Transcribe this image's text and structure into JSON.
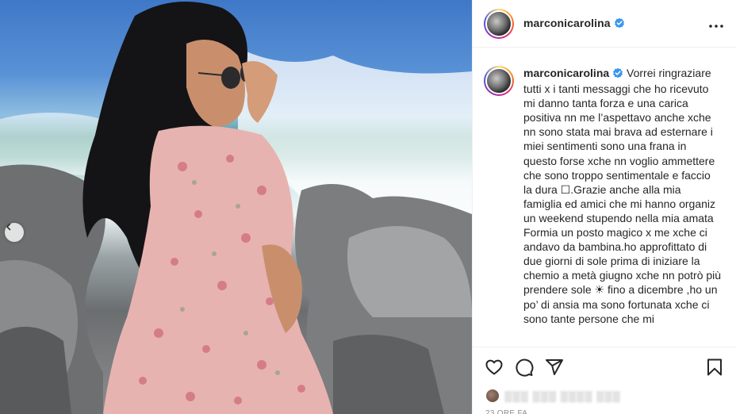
{
  "post": {
    "username": "marconicarolina",
    "verified": true,
    "caption": "Vorrei ringraziare tutti x i tanti messaggi che ho ricevuto mi danno tanta forza e una carica positiva nn me l’aspettavo anche xche nn sono stata mai brava ad esternare i miei sentimenti sono una frana in questo forse xche nn voglio ammettere che sono troppo sentimentale e faccio la dura ☐.Grazie anche alla mia famiglia ed amici che mi hanno organiz un weekend stupendo nella mia amata Formia un posto magico x me xche ci andavo da bambina.ho approfittato di due giorni di sole prima di iniziare la chemio a metà giugno xche nn potrò più prendere sole ☀ fino a dicembre ,ho un po’ di ansia ma sono fortunata xche ci sono tante persone che mi",
    "likes_text": "░░░  ░░░ ░░░░ ░░░",
    "time_label": "23 ORE FA"
  },
  "icons": {
    "verified": "verified-badge-icon",
    "more": "more-options-icon",
    "like": "heart-icon",
    "comment": "comment-icon",
    "share": "paper-plane-icon",
    "save": "bookmark-icon",
    "carousel_prev": "chevron-left-icon"
  },
  "colors": {
    "verified": "#3897f0",
    "text": "#262626",
    "muted": "#8e8e8e",
    "border": "#efefef"
  }
}
